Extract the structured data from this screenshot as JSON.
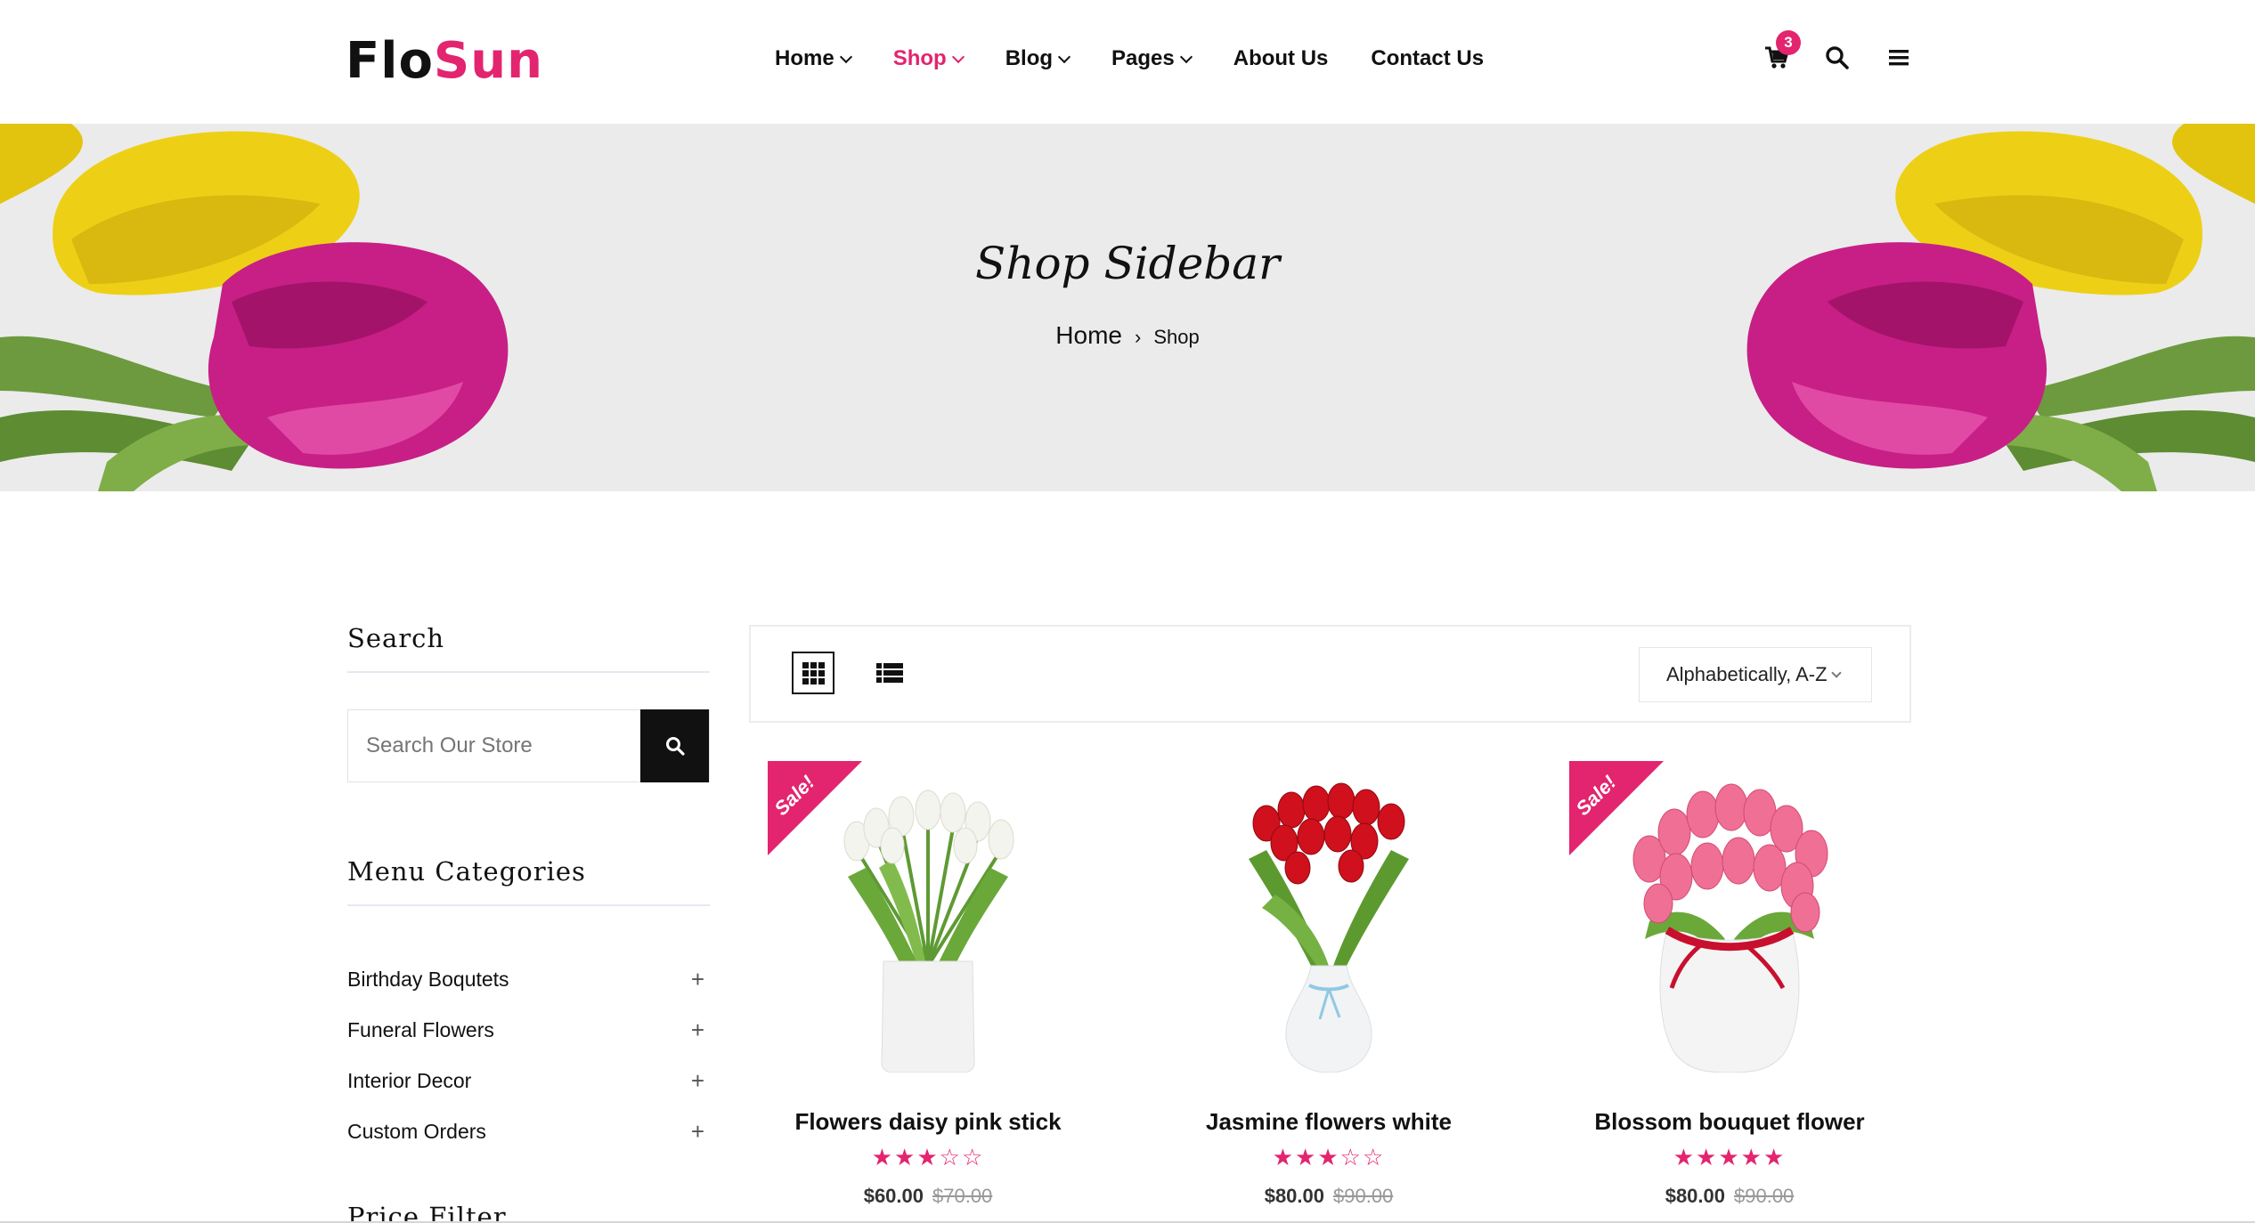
{
  "brand": {
    "part1": "Flo",
    "part2": "Sun",
    "accent": "#e3246f"
  },
  "nav": [
    {
      "label": "Home",
      "dropdown": true,
      "active": false
    },
    {
      "label": "Shop",
      "dropdown": true,
      "active": true
    },
    {
      "label": "Blog",
      "dropdown": true,
      "active": false
    },
    {
      "label": "Pages",
      "dropdown": true,
      "active": false
    },
    {
      "label": "About Us",
      "dropdown": false,
      "active": false
    },
    {
      "label": "Contact Us",
      "dropdown": false,
      "active": false
    }
  ],
  "header_icons": {
    "cart_count": "3",
    "cart": "cart-icon",
    "search": "search-icon",
    "menu": "hamburger-menu-icon"
  },
  "hero": {
    "title": "Shop Sidebar",
    "breadcrumb": {
      "home": "Home",
      "separator": "›",
      "current": "Shop"
    }
  },
  "sidebar": {
    "search_title": "Search",
    "search_placeholder": "Search Our Store",
    "categories_title": "Menu Categories",
    "categories": [
      {
        "label": "Birthday Boqutets"
      },
      {
        "label": "Funeral Flowers"
      },
      {
        "label": "Interior Decor"
      },
      {
        "label": "Custom Orders"
      }
    ],
    "price_title": "Price Filter"
  },
  "toolbar": {
    "sort_label": "Alphabetically, A-Z",
    "active_view": "grid"
  },
  "products": [
    {
      "name": "Flowers daisy pink stick",
      "rating": 3,
      "price": "$60.00",
      "old_price": "$70.00",
      "sale": "Sale!"
    },
    {
      "name": "Jasmine flowers white",
      "rating": 3,
      "price": "$80.00",
      "old_price": "$90.00",
      "sale": ""
    },
    {
      "name": "Blossom bouquet flower",
      "rating": 5,
      "price": "$80.00",
      "old_price": "$90.00",
      "sale": "Sale!"
    }
  ]
}
